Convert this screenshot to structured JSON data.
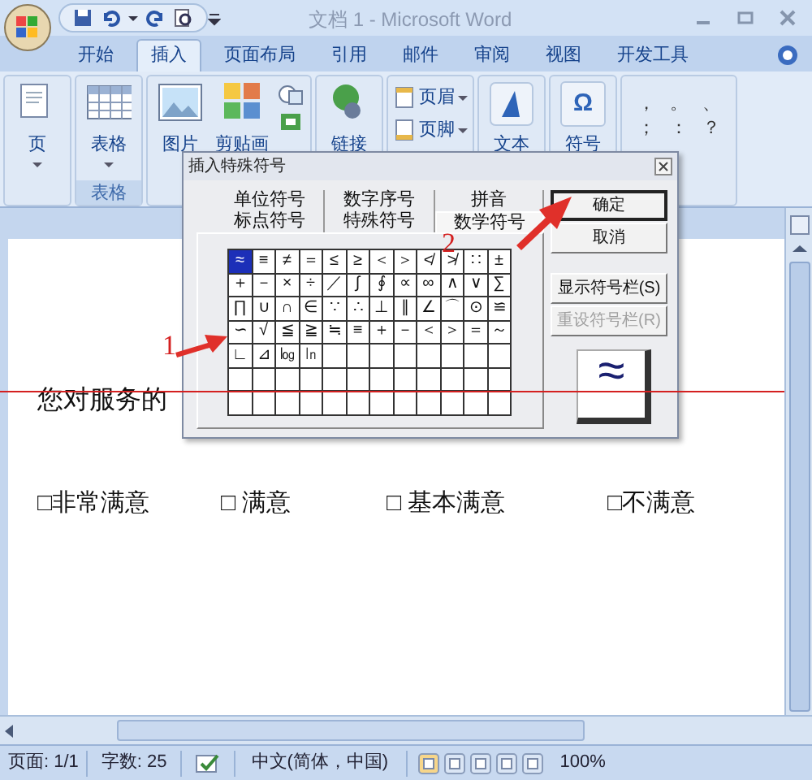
{
  "window": {
    "title": "文档 1 - Microsoft Word"
  },
  "ribbon_tabs": [
    {
      "label": "开始",
      "selected": false
    },
    {
      "label": "插入",
      "selected": true
    },
    {
      "label": "页面布局",
      "selected": false
    },
    {
      "label": "引用",
      "selected": false
    },
    {
      "label": "邮件",
      "selected": false
    },
    {
      "label": "审阅",
      "selected": false
    },
    {
      "label": "视图",
      "selected": false
    },
    {
      "label": "开发工具",
      "selected": false
    }
  ],
  "ribbon_groups": [
    {
      "items": [
        {
          "kind": "page",
          "label": "页",
          "dropdown": true
        }
      ]
    },
    {
      "label": "表格",
      "items": [
        {
          "kind": "table",
          "label": "表格",
          "dropdown": true
        }
      ]
    },
    {
      "items": [
        {
          "kind": "picture",
          "label": "图片"
        },
        {
          "kind": "clipart",
          "label": "剪贴画"
        },
        {
          "kind": "shapes"
        }
      ]
    },
    {
      "items": [
        {
          "kind": "link",
          "label": "链接"
        }
      ]
    },
    {
      "items": [
        {
          "kind": "header",
          "label": "页眉",
          "dropdown": true
        },
        {
          "kind": "footer",
          "label": "页脚",
          "dropdown": true
        }
      ]
    },
    {
      "items": [
        {
          "kind": "text",
          "label": "文本"
        }
      ]
    },
    {
      "items": [
        {
          "kind": "symbol",
          "glyph": "Ω",
          "label": "符号"
        }
      ]
    },
    {
      "items": [
        {
          "kind": "marks",
          "marks": [
            "，",
            "。",
            "、",
            "；",
            "：",
            "？"
          ]
        }
      ]
    }
  ],
  "document": {
    "heading": "您对服务的",
    "options": [
      "□非常满意",
      "□ 满意",
      "□ 基本满意",
      "□不满意"
    ]
  },
  "dialog": {
    "title": "插入特殊符号",
    "tab_rows": [
      [
        {
          "label": "单位符号",
          "selected": false
        },
        {
          "label": "数字序号",
          "selected": false
        },
        {
          "label": "拼音",
          "selected": false
        }
      ],
      [
        {
          "label": "标点符号",
          "selected": false
        },
        {
          "label": "特殊符号",
          "selected": false
        },
        {
          "label": "数学符号",
          "selected": true
        }
      ]
    ],
    "grid": [
      [
        {
          "char": "≈",
          "selected": true
        },
        {
          "char": "≡",
          "selected": false
        },
        {
          "char": "≠",
          "selected": false
        },
        {
          "char": "＝",
          "selected": false
        },
        {
          "char": "≤",
          "selected": false
        },
        {
          "char": "≥",
          "selected": false
        },
        {
          "char": "＜",
          "selected": false
        },
        {
          "char": "＞",
          "selected": false
        },
        {
          "char": "≮",
          "selected": false
        },
        {
          "char": "≯",
          "selected": false
        },
        {
          "char": "∷",
          "selected": false
        },
        {
          "char": "±",
          "selected": false
        }
      ],
      [
        {
          "char": "＋",
          "selected": false
        },
        {
          "char": "－",
          "selected": false
        },
        {
          "char": "×",
          "selected": false
        },
        {
          "char": "÷",
          "selected": false
        },
        {
          "char": "／",
          "selected": false
        },
        {
          "char": "∫",
          "selected": false
        },
        {
          "char": "∮",
          "selected": false
        },
        {
          "char": "∝",
          "selected": false
        },
        {
          "char": "∞",
          "selected": false
        },
        {
          "char": "∧",
          "selected": false
        },
        {
          "char": "∨",
          "selected": false
        },
        {
          "char": "∑",
          "selected": false
        }
      ],
      [
        {
          "char": "∏",
          "selected": false
        },
        {
          "char": "∪",
          "selected": false
        },
        {
          "char": "∩",
          "selected": false
        },
        {
          "char": "∈",
          "selected": false
        },
        {
          "char": "∵",
          "selected": false
        },
        {
          "char": "∴",
          "selected": false
        },
        {
          "char": "⊥",
          "selected": false
        },
        {
          "char": "∥",
          "selected": false
        },
        {
          "char": "∠",
          "selected": false
        },
        {
          "char": "⌒",
          "selected": false
        },
        {
          "char": "⊙",
          "selected": false
        },
        {
          "char": "≌",
          "selected": false
        }
      ],
      [
        {
          "char": "∽",
          "selected": false
        },
        {
          "char": "√",
          "selected": false
        },
        {
          "char": "≦",
          "selected": false
        },
        {
          "char": "≧",
          "selected": false
        },
        {
          "char": "≒",
          "selected": false
        },
        {
          "char": "≡",
          "selected": false
        },
        {
          "char": "＋",
          "selected": false
        },
        {
          "char": "－",
          "selected": false
        },
        {
          "char": "＜",
          "selected": false
        },
        {
          "char": "＞",
          "selected": false
        },
        {
          "char": "＝",
          "selected": false
        },
        {
          "char": "～",
          "selected": false
        }
      ],
      [
        {
          "char": "∟",
          "selected": false
        },
        {
          "char": "⊿",
          "selected": false
        },
        {
          "char": "㏒",
          "selected": false
        },
        {
          "char": "㏑",
          "selected": false
        },
        {
          "selected": false
        },
        {
          "selected": false
        },
        {
          "selected": false
        },
        {
          "selected": false
        },
        {
          "selected": false
        },
        {
          "selected": false
        },
        {
          "selected": false
        },
        {
          "selected": false
        }
      ],
      [
        {
          "selected": false
        },
        {
          "selected": false
        },
        {
          "selected": false
        },
        {
          "selected": false
        },
        {
          "selected": false
        },
        {
          "selected": false
        },
        {
          "selected": false
        },
        {
          "selected": false
        },
        {
          "selected": false
        },
        {
          "selected": false
        },
        {
          "selected": false
        },
        {
          "selected": false
        }
      ],
      [
        {
          "selected": false
        },
        {
          "selected": false
        },
        {
          "selected": false
        },
        {
          "selected": false
        },
        {
          "selected": false
        },
        {
          "selected": false
        },
        {
          "selected": false
        },
        {
          "selected": false
        },
        {
          "selected": false
        },
        {
          "selected": false
        },
        {
          "selected": false
        },
        {
          "selected": false
        }
      ]
    ],
    "buttons": [
      {
        "label": "确定",
        "kind": "default",
        "disabled": false
      },
      {
        "label": "取消",
        "kind": "normal",
        "disabled": false
      },
      {
        "label": "显示符号栏(S)",
        "kind": "normal",
        "disabled": false
      },
      {
        "label": "重设符号栏(R)",
        "kind": "normal",
        "disabled": true
      }
    ],
    "preview": "≈"
  },
  "annotations": [
    {
      "label": "1"
    },
    {
      "label": "2"
    }
  ],
  "status_bar": {
    "page": "页面: 1/1",
    "words": "字数: 25",
    "language": "中文(简体，中国)",
    "zoom": "100%"
  }
}
